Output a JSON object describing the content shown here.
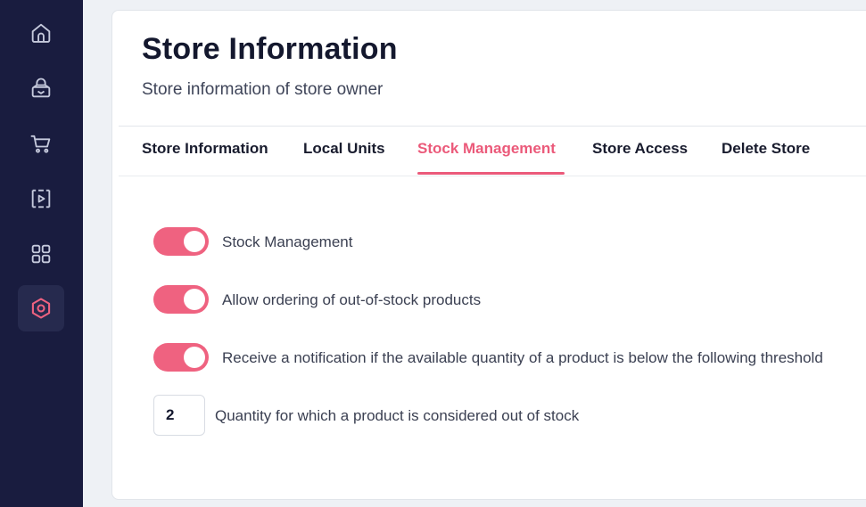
{
  "sidebar": {
    "items": [
      {
        "icon": "home-icon"
      },
      {
        "icon": "shopping-bag-icon"
      },
      {
        "icon": "cart-icon"
      },
      {
        "icon": "media-icon"
      },
      {
        "icon": "grid-icon"
      },
      {
        "icon": "settings-hexagon-icon",
        "active": true
      }
    ]
  },
  "header": {
    "title": "Store Information",
    "subtitle": "Store information of store owner"
  },
  "tabs": [
    {
      "label": "Store Information"
    },
    {
      "label": "Local Units"
    },
    {
      "label": "Stock Management",
      "active": true
    },
    {
      "label": "Store Access"
    },
    {
      "label": "Delete Store"
    }
  ],
  "stock": {
    "options": [
      {
        "label": "Stock Management",
        "enabled": true
      },
      {
        "label": "Allow ordering of out-of-stock products",
        "enabled": true
      },
      {
        "label": "Receive a notification if the available quantity of a product is below the following threshold",
        "enabled": true
      }
    ],
    "threshold": {
      "value": "2",
      "label": "Quantity for which a product is considered out of stock"
    }
  },
  "colors": {
    "accent": "#ef6280",
    "sidebar_bg": "#191c3f",
    "icon_default": "#c5c9dc"
  }
}
